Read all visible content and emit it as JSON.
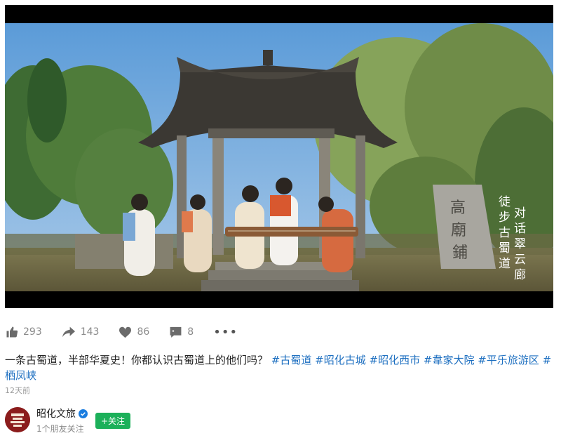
{
  "post": {
    "stats": {
      "likes": "293",
      "shares": "143",
      "favorites": "86",
      "comments": "8"
    },
    "more_label": "•••",
    "caption_text": "一条古蜀道，半部华夏史！你都认识古蜀道上的他们吗？",
    "hashtags": [
      "#古蜀道",
      "#昭化古城",
      "#昭化西市",
      "#韋家大院",
      "#平乐旅游区",
      "#栖凤峡"
    ],
    "time": "12天前"
  },
  "video": {
    "overlay_vertical_text_left": "徒步古蜀道",
    "overlay_vertical_text_right": "对话翠云廊",
    "stone_inscription": "高廟鋪",
    "progress": 0.13
  },
  "author": {
    "name": "昭化文旅",
    "subtitle": "1个朋友关注",
    "follow_label": "+关注",
    "verified_icon": "verified-check-icon"
  },
  "colors": {
    "hashtag": "#1d6fc0",
    "follow_bg": "#1cb05a",
    "verified": "#1a7de0"
  }
}
